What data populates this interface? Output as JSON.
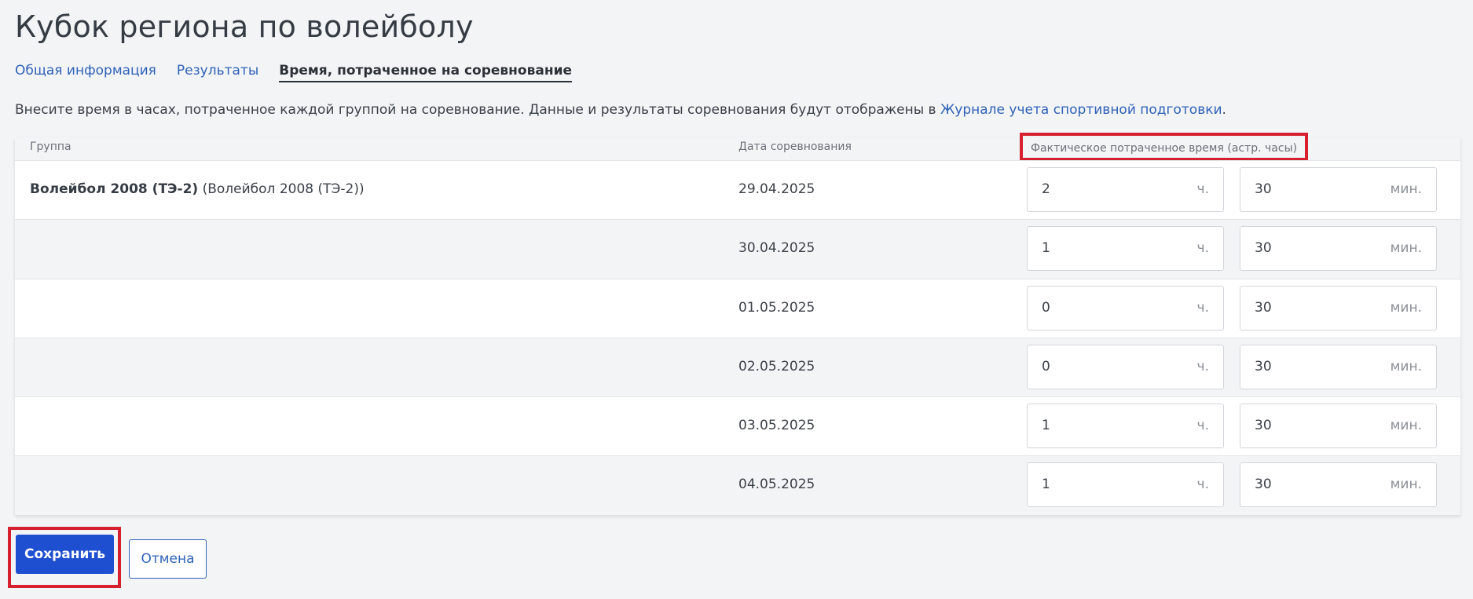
{
  "page": {
    "title": "Кубок региона по волейболу"
  },
  "tabs": [
    {
      "label": "Общая информация"
    },
    {
      "label": "Результаты"
    },
    {
      "label": "Время, потраченное на соревнование"
    }
  ],
  "intro": {
    "text": "Внесите время в часах, потраченное каждой группой на соревнование. Данные и результаты соревнования будут отображены в ",
    "link": "Журнале учета спортивной подготовки",
    "suffix": "."
  },
  "table": {
    "headers": {
      "group": "Группа",
      "date": "Дата соревнования",
      "time": "Фактическое потраченное время (астр. часы)"
    },
    "units": {
      "hours": "ч.",
      "minutes": "мин."
    },
    "group_name": "Волейбол 2008 (ТЭ-2)",
    "group_alias": "(Волейбол 2008 (ТЭ-2))",
    "rows": [
      {
        "date": "29.04.2025",
        "hours": "2",
        "minutes": "30"
      },
      {
        "date": "30.04.2025",
        "hours": "1",
        "minutes": "30"
      },
      {
        "date": "01.05.2025",
        "hours": "0",
        "minutes": "30"
      },
      {
        "date": "02.05.2025",
        "hours": "0",
        "minutes": "30"
      },
      {
        "date": "03.05.2025",
        "hours": "1",
        "minutes": "30"
      },
      {
        "date": "04.05.2025",
        "hours": "1",
        "minutes": "30"
      }
    ]
  },
  "actions": {
    "save_label": "Сохранить",
    "cancel_label": "Отмена"
  },
  "colors": {
    "primary": "#1f4fd1",
    "link": "#2f62b8",
    "highlight": "#d6202f"
  }
}
